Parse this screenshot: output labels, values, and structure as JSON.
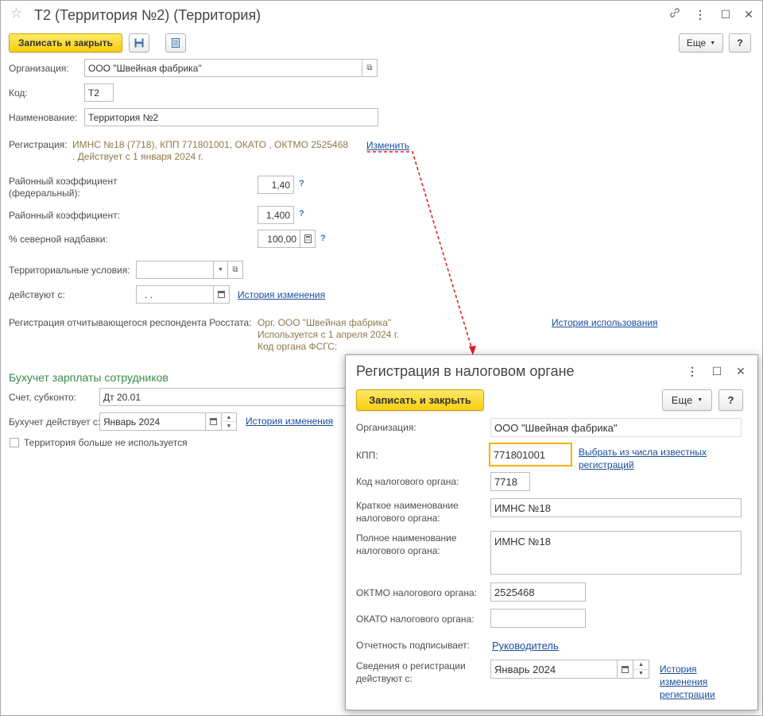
{
  "window": {
    "title": "Т2 (Территория №2) (Территория)",
    "header_icons": [
      "star-icon",
      "link-icon",
      "more-icon",
      "maximize-icon",
      "close-icon"
    ],
    "more_glyph": "⋮",
    "maximize_glyph": "☐",
    "close_glyph": "✕"
  },
  "toolbar": {
    "save_close": "Записать и закрыть",
    "more": "Еще",
    "help": "?"
  },
  "form": {
    "organization_label": "Организация:",
    "organization_value": "ООО \"Швейная фабрика\"",
    "code_label": "Код:",
    "code_value": "Т2",
    "name_label": "Наименование:",
    "name_value": "Территория №2",
    "registration_label": "Регистрация:",
    "registration_line1": "ИМНС №18 (7718), КПП 771801001, ОКАТО , ОКТМО 2525468",
    "registration_line2": ". Действует с 1 января 2024 г.",
    "registration_change": "Изменить",
    "district_fed_label_1": "Районный коэффициент",
    "district_fed_label_2": "(федеральный):",
    "district_fed_value": "1,40",
    "district_label": "Районный коэффициент:",
    "district_value": "1,400",
    "north_label": "% северной надбавки:",
    "north_value": "100,00",
    "help_mark": "?",
    "terr_cond_label": "Территориальные условия:",
    "terr_cond_value": "",
    "valid_from_label": "действуют с:",
    "valid_from_value": ". .",
    "history_link": "История изменения",
    "rosstat_label": "Регистрация отчитывающегося респондента Росстата:",
    "rosstat_line1": "Орг. ООО \"Швейная фабрика\"",
    "rosstat_line2": "Используется с 1 апреля 2024 г.",
    "rosstat_line3": "Код органа ФСГС:",
    "usage_history_link": "История использования"
  },
  "accounting": {
    "section_title": "Бухучет зарплаты сотрудников",
    "account_label": "Счет, субконто:",
    "account_value": "Дт 20.01",
    "valid_label": "Бухучет действует с:",
    "valid_value": "Январь 2024",
    "history_link": "История изменения",
    "not_used_label": "Территория больше не используется",
    "not_used_checked": false
  },
  "dialog": {
    "title": "Регистрация в налоговом органе",
    "save_close": "Записать и закрыть",
    "more": "Еще",
    "help": "?",
    "org_label": "Организация:",
    "org_value": "ООО \"Швейная фабрика\"",
    "kpp_label": "КПП:",
    "kpp_value": "771801001",
    "choose_link_1": "Выбрать из числа известных",
    "choose_link_2": "регистраций",
    "tax_code_label": "Код налогового органа:",
    "tax_code_value": "7718",
    "short_name_label_1": "Краткое наименование",
    "short_name_label_2": "налогового органа:",
    "short_name_value": "ИМНС №18",
    "full_name_label_1": "Полное наименование",
    "full_name_label_2": "налогового органа:",
    "full_name_value": "ИМНС №18",
    "oktmo_label": "ОКТМО налогового органа:",
    "oktmo_value": "2525468",
    "okato_label": "ОКАТО налогового органа:",
    "okato_value": "",
    "signer_label": "Отчетность подписывает:",
    "signer_link": "Руководитель",
    "valid_label_1": "Сведения о регистрации",
    "valid_label_2": "действуют с:",
    "valid_value": "Январь 2024",
    "history_link_1": "История",
    "history_link_2": "изменения",
    "history_link_3": "регистрации"
  },
  "colors": {
    "accent_yellow": "#f8cf10",
    "link_blue": "#1a4d9c",
    "registration_text": "#8a7b4a",
    "section_green": "#3a8a4a",
    "focus_border": "#f0b400",
    "arrow_red": "#e02020"
  }
}
